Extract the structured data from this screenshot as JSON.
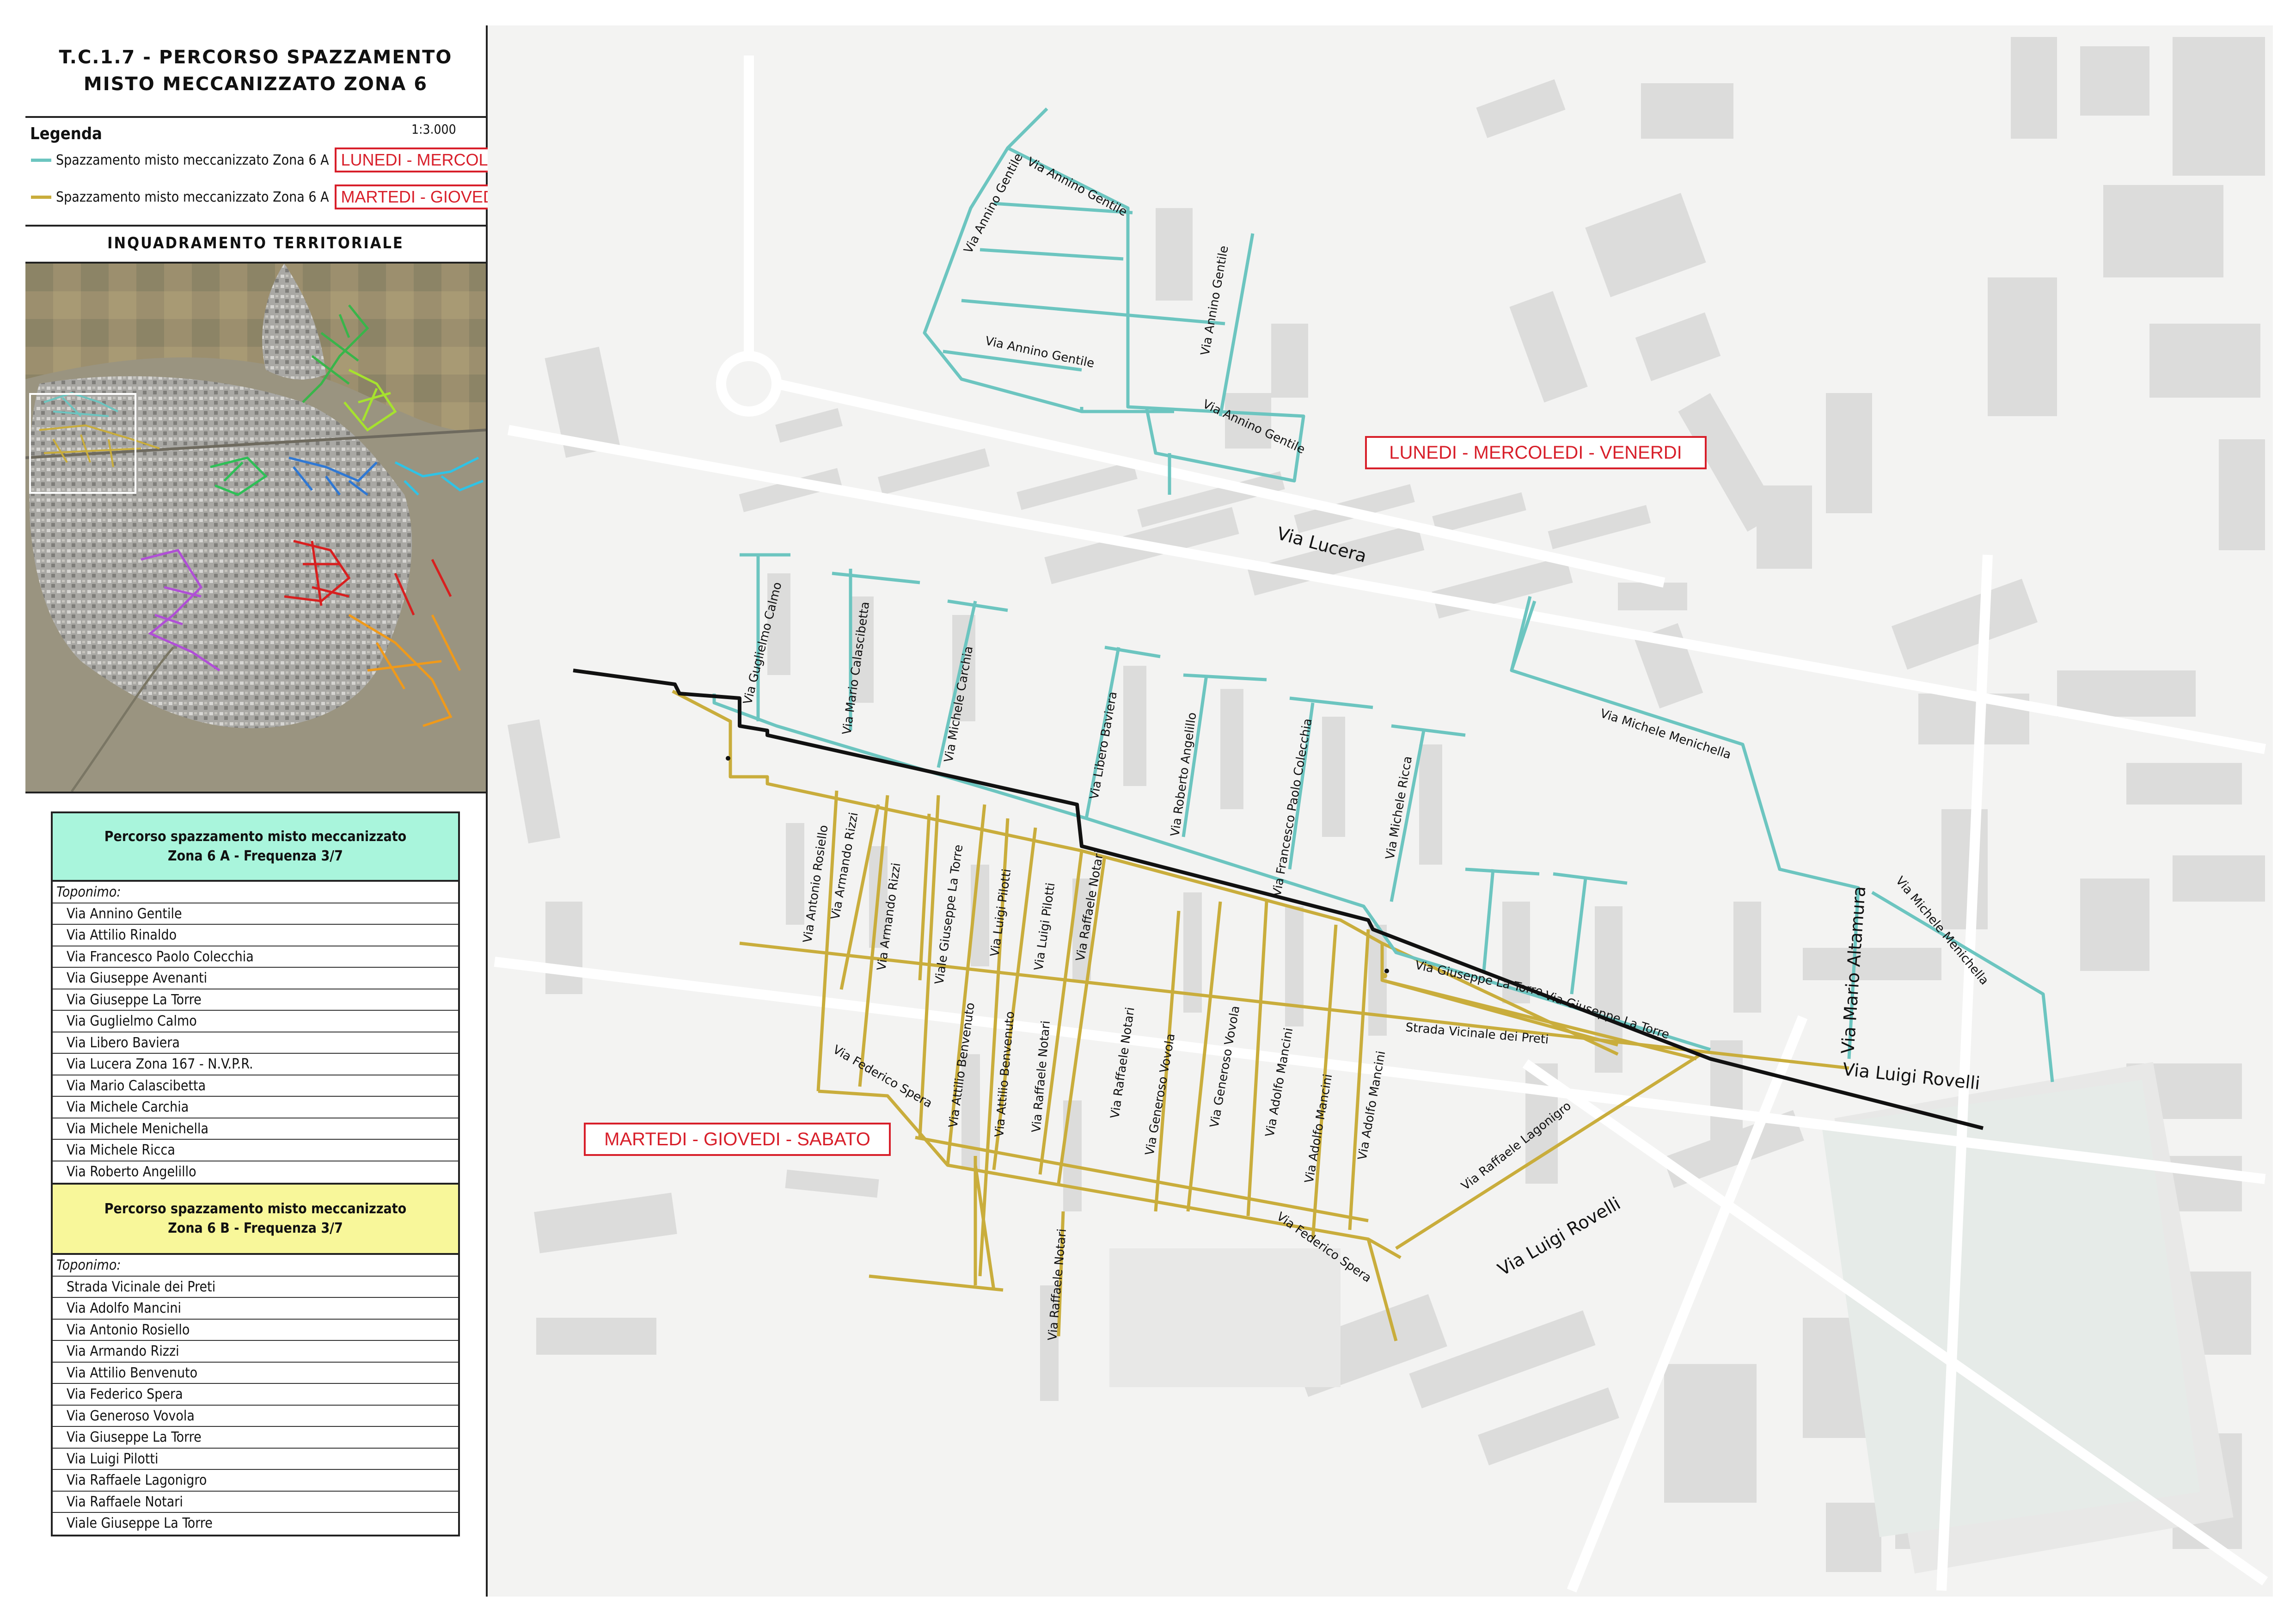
{
  "title": {
    "line1": "T.C.1.7 - PERCORSO SPAZZAMENTO",
    "line2": "MISTO MECCANIZZATO ZONA 6"
  },
  "legend": {
    "heading": "Legenda",
    "scale": "1:3.000",
    "items": [
      {
        "label": "Spazzamento misto meccanizzato Zona 6 A",
        "color": "#6cc5c0",
        "days": "LUNEDI - MERCOLEDI - VENERDI"
      },
      {
        "label": "Spazzamento misto meccanizzato Zona 6 A",
        "color": "#c9ad3c",
        "days": "MARTEDI - GIOVEDI - SABATO"
      }
    ]
  },
  "inquadramento": {
    "title": "INQUADRAMENTO TERRITORIALE"
  },
  "table_a": {
    "header_line1": "Percorso spazzamento misto meccanizzato",
    "header_line2": "Zona 6 A - Frequenza 3/7",
    "header_color": "#a9f5dc",
    "subheading": "Toponimo:",
    "rows": [
      "Via Annino Gentile",
      "Via Attilio Rinaldo",
      "Via Francesco Paolo Colecchia",
      "Via Giuseppe Avenanti",
      "Via Giuseppe La Torre",
      "Via Guglielmo Calmo",
      "Via Libero Baviera",
      "Via Lucera Zona 167 - N.V.P.R.",
      "Via Mario Calascibetta",
      "Via Michele Carchia",
      "Via Michele Menichella",
      "Via Michele Ricca",
      "Via Roberto Angelillo"
    ]
  },
  "table_b": {
    "header_line1": "Percorso spazzamento misto meccanizzato",
    "header_line2": "Zona 6 B - Frequenza 3/7",
    "header_color": "#f8f79a",
    "subheading": "Toponimo:",
    "rows": [
      "Strada Vicinale dei Preti",
      "Via Adolfo Mancini",
      "Via Antonio Rosiello",
      "Via Armando Rizzi",
      "Via Attilio Benvenuto",
      "Via Federico Spera",
      "Via Generoso Vovola",
      "Via Giuseppe La Torre",
      "Via Luigi Pilotti",
      "Via Raffaele Lagonigro",
      "Via Raffaele Notari",
      "Viale Giuseppe La Torre"
    ]
  },
  "map_labels": {
    "day_a": "LUNEDI - MERCOLEDI - VENERDI",
    "day_b": "MARTEDI - GIOVEDI - SABATO",
    "via_lucera": "Via Lucera",
    "via_luigi_rovelli_1": "Via Luigi Rovelli",
    "via_luigi_rovelli_2": "Via Luigi Rovelli",
    "via_mario_altamura": "Via Mario Altamura",
    "annino_1": "Via Annino Gentile",
    "annino_2": "Via Annino Gentile",
    "annino_3": "Via Annino Gentile",
    "annino_4": "Via Annino Gentile",
    "annino_5": "Via Annino Gentile",
    "calmo": "Via Guglielmo Calmo",
    "calascibetta": "Via Mario Calascibetta",
    "carchia": "Via Michele Carchia",
    "baviera": "Via Libero Baviera",
    "angelillo": "Via Roberto Angelillo",
    "colecchia": "Via Francesco Paolo Colecchia",
    "ricca": "Via Michele Ricca",
    "menichella_1": "Via Michele Menichella",
    "menichella_2": "Via Michele Menichella",
    "latorre_1": "Via Giuseppe La Torre",
    "latorre_2": "Via Giuseppe La Torre",
    "rosiello": "Via Antonio Rosiello",
    "rizzi_1": "Via Armando Rizzi",
    "rizzi_2": "Via Armando Rizzi",
    "viale_latorre": "Viale Giuseppe La Torre",
    "pilotti_1": "Via Luigi Pilotti",
    "pilotti_2": "Via Luigi Pilotti",
    "notari_1": "Via Raffaele Notari",
    "notari_2": "Via Raffaele Notari",
    "notari_3": "Via Raffaele Notari",
    "notari_4": "Via Raffaele Notari",
    "benvenuto_1": "Via Attilio Benvenuto",
    "benvenuto_2": "Via Attilio Benvenuto",
    "vovola_1": "Via Generoso Vovola",
    "vovola_2": "Via Generoso Vovola",
    "mancini_1": "Via Adolfo Mancini",
    "mancini_2": "Via Adolfo Mancini",
    "mancini_3": "Via Adolfo Mancini",
    "spera_1": "Via Federico Spera",
    "spera_2": "Via Federico Spera",
    "vicinale": "Strada Vicinale dei Preti",
    "lagonigro": "Via Raffaele Lagonigro"
  }
}
